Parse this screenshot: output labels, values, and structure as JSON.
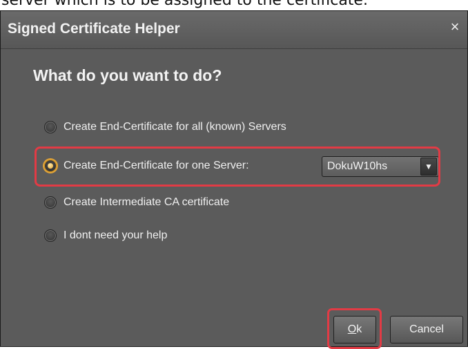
{
  "doc_snippet": "server which is to be assigned to the certificate.",
  "dialog": {
    "title": "Signed Certificate Helper",
    "close_symbol": "×",
    "heading": "What do you want to do?",
    "options": [
      {
        "label": "Create End-Certificate for all (known) Servers",
        "selected": false
      },
      {
        "label": "Create End-Certificate for one Server:",
        "selected": true
      },
      {
        "label": "Create Intermediate CA certificate",
        "selected": false
      },
      {
        "label": "I dont need your help",
        "selected": false
      }
    ],
    "server_select": {
      "value": "DokuW10hs",
      "arrow": "▼"
    },
    "buttons": {
      "ok_mnemonic": "O",
      "ok_rest": "k",
      "cancel": "Cancel"
    }
  },
  "colors": {
    "highlight": "#e23b45",
    "dialog_bg": "#5b5b5b",
    "selected_radio": "#e6a832"
  }
}
